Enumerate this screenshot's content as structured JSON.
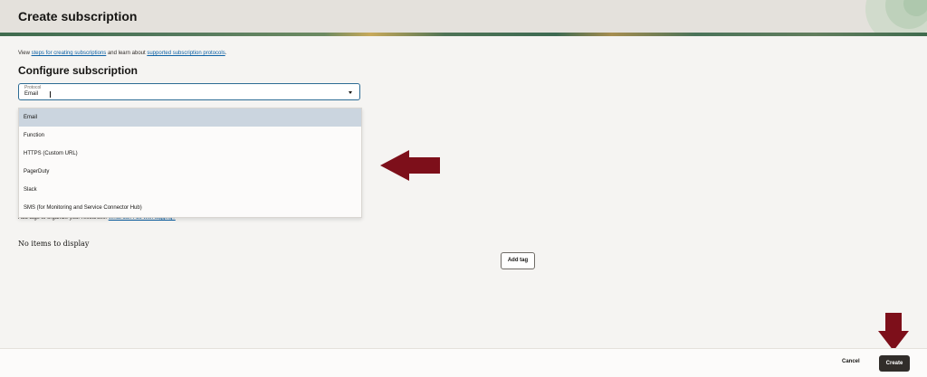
{
  "header": {
    "title": "Create subscription"
  },
  "intro": {
    "prefix": "View ",
    "link1": "steps for creating subscriptions",
    "middle": " and learn about ",
    "link2": "supported subscription protocols",
    "suffix": "."
  },
  "section": {
    "title": "Configure subscription"
  },
  "protocol": {
    "label": "Protocol",
    "value": "Email",
    "options": [
      "Email",
      "Function",
      "HTTPS (Custom URL)",
      "PagerDuty",
      "Slack",
      "SMS (for Monitoring and Service Connector Hub)"
    ],
    "selected_index": 0
  },
  "tags": {
    "text": "Add tags to organize your resources.",
    "link": "What can I do with tagging?",
    "empty": "No items to display",
    "add_label": "Add tag"
  },
  "footer": {
    "cancel_label": "Cancel",
    "create_label": "Create"
  },
  "colors": {
    "annotation_arrow": "#7d0f1a",
    "primary_button": "#312d2a",
    "link": "#0c61a5"
  }
}
